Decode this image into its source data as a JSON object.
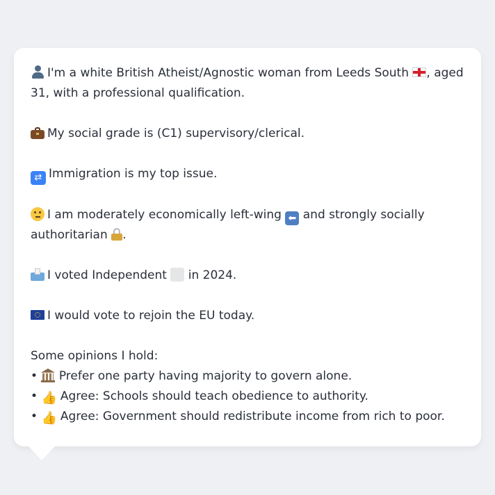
{
  "profile": {
    "line1a": "I'm a white British Atheist/Agnostic woman from Leeds South",
    "line1b": ", aged",
    "line1c": "31, with a professional qualification.",
    "grade": "My social grade is (C1) supervisory/clerical.",
    "issue": "Immigration is my top issue.",
    "ideology_a": "I am moderately economically left-wing",
    "ideology_b": "and strongly socially",
    "ideology_c": "authoritarian",
    "ideology_d": ".",
    "vote_a": "I voted Independent",
    "vote_b": "in 2024.",
    "eu": "I would vote to rejoin the EU today."
  },
  "opinions": {
    "heading": "Some opinions I hold:",
    "bullet": "•",
    "items": [
      {
        "text": "Prefer one party having majority to govern alone.",
        "icon": "classical-building-icon"
      },
      {
        "text": "Agree: Schools should teach obedience to authority.",
        "icon": "thumbs-up-icon"
      },
      {
        "text": "Agree: Government should redistribute income from rich to poor.",
        "icon": "thumbs-up-icon"
      }
    ]
  },
  "icons": {
    "person": "person-silhouette-icon",
    "flag": "england-flag-icon",
    "briefcase": "briefcase-icon",
    "passport": "passport-control-icon",
    "thinking": "thinking-face-icon",
    "left_arrow": "left-arrow-icon",
    "lock": "lock-icon",
    "ballot": "ballot-box-icon",
    "independent": "grey-square-icon",
    "eu_flag": "eu-flag-icon"
  },
  "colors": {
    "background": "#eef0f3",
    "bubble": "#ffffff",
    "text": "#2a2f3a"
  }
}
